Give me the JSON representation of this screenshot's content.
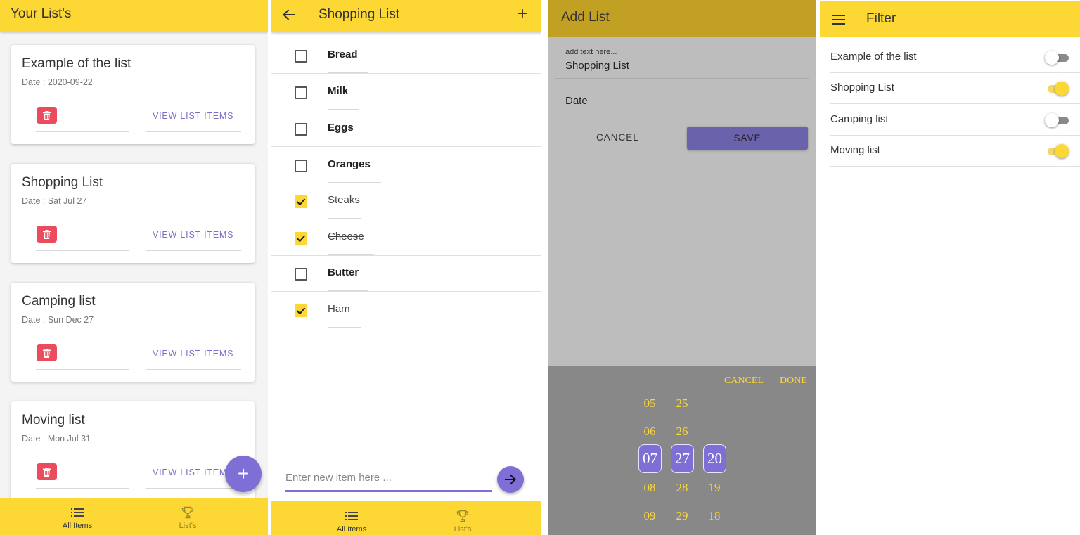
{
  "your_lists": {
    "title": "Your List's",
    "cards": [
      {
        "title": "Example of the list",
        "date": "Date : 2020-09-22",
        "action": "VIEW LIST ITEMS"
      },
      {
        "title": "Shopping List",
        "date": "Date : Sat Jul 27",
        "action": "VIEW LIST ITEMS"
      },
      {
        "title": "Camping list",
        "date": "Date : Sun Dec 27",
        "action": "VIEW LIST ITEMS"
      },
      {
        "title": "Moving list",
        "date": "Date : Mon Jul 31",
        "action": "VIEW LIST ITEMS"
      }
    ],
    "fab_icon": "+",
    "nav": [
      {
        "label": "All Items",
        "icon": "list-icon",
        "active": true
      },
      {
        "label": "List's",
        "icon": "trophy-icon",
        "active": false
      }
    ]
  },
  "shopping_list": {
    "title": "Shopping List",
    "add_icon": "+",
    "items": [
      {
        "name": "Bread",
        "checked": false
      },
      {
        "name": "Milk",
        "checked": false
      },
      {
        "name": "Eggs",
        "checked": false
      },
      {
        "name": "Oranges",
        "checked": false
      },
      {
        "name": "Steaks",
        "checked": true
      },
      {
        "name": "Cheese",
        "checked": true
      },
      {
        "name": "Butter",
        "checked": false
      },
      {
        "name": "Ham",
        "checked": true
      }
    ],
    "input_placeholder": "Enter new item here ...",
    "nav": [
      {
        "label": "All Items",
        "icon": "list-icon",
        "active": true
      },
      {
        "label": "List's",
        "icon": "trophy-icon",
        "active": false
      }
    ]
  },
  "add_list": {
    "title": "Add List",
    "text_placeholder": "add text here...",
    "text_value": "Shopping List",
    "date_label": "Date",
    "cancel": "CANCEL",
    "save": "SAVE",
    "picker": {
      "cancel": "CANCEL",
      "done": "DONE",
      "columns": [
        {
          "values": [
            "05",
            "06",
            "07",
            "08",
            "09"
          ],
          "selected": "07"
        },
        {
          "values": [
            "25",
            "26",
            "27",
            "28",
            "29"
          ],
          "selected": "27"
        },
        {
          "values": [
            "",
            "",
            "20",
            "19",
            "18"
          ],
          "selected": "20"
        }
      ]
    }
  },
  "filter": {
    "title": "Filter",
    "items": [
      {
        "label": "Example of the list",
        "on": false
      },
      {
        "label": "Shopping List",
        "on": true
      },
      {
        "label": "Camping list",
        "on": false
      },
      {
        "label": "Moving list",
        "on": true
      }
    ]
  },
  "colors": {
    "header_yellow": "#fdd835",
    "accent_purple": "#7e6fd6",
    "delete_red": "#ea4b5d",
    "link_purple": "#7b6fc9"
  }
}
